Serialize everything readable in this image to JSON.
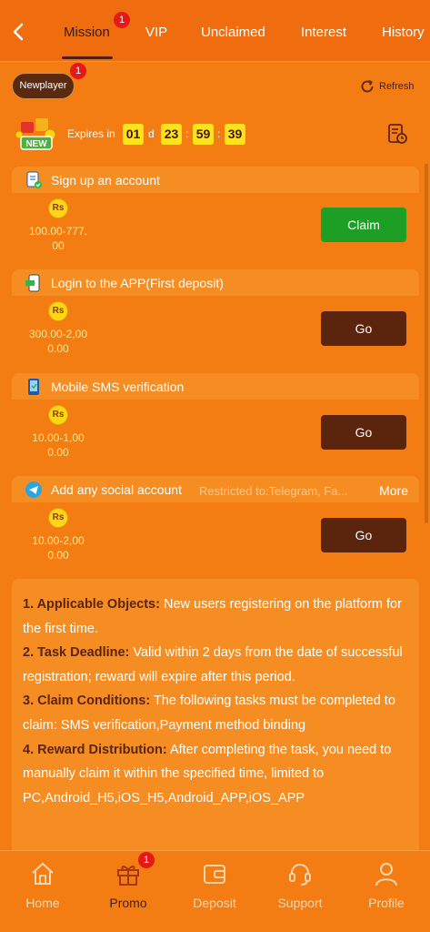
{
  "topnav": {
    "tabs": [
      {
        "label": "Mission",
        "badge": "1"
      },
      {
        "label": "VIP"
      },
      {
        "label": "Unclaimed"
      },
      {
        "label": "Interest"
      },
      {
        "label": "History"
      }
    ]
  },
  "subheader": {
    "newplayer_label": "Newplayer",
    "newplayer_badge": "1",
    "refresh_label": "Refresh",
    "new_tag": "NEW",
    "expires_label": "Expires in",
    "days": "01",
    "day_unit": "d",
    "hours": "23",
    "minutes": "59",
    "seconds": "39",
    "sep": ":"
  },
  "tasks": [
    {
      "title": "Sign up an account",
      "currency": "Rs",
      "reward_line1": "100.00-777.",
      "reward_line2": "00",
      "button": "Claim",
      "icon": "account-icon"
    },
    {
      "title": "Login to the APP(First deposit)",
      "currency": "Rs",
      "reward_line1": "300.00-2,00",
      "reward_line2": "0.00",
      "button": "Go",
      "icon": "app-login-icon"
    },
    {
      "title": "Mobile SMS verification",
      "currency": "Rs",
      "reward_line1": "10.00-1,00",
      "reward_line2": "0.00",
      "button": "Go",
      "icon": "mobile-sms-icon"
    },
    {
      "title": "Add any social account",
      "restricted": "Restricted to:Telegram, Fa...",
      "more": "More",
      "currency": "Rs",
      "reward_line1": "10.00-2,00",
      "reward_line2": "0.00",
      "button": "Go",
      "icon": "social-icon"
    }
  ],
  "rules": [
    {
      "head": "1. Applicable Objects:",
      "text": " New users registering on the platform for the first time."
    },
    {
      "head": "2. Task Deadline:",
      "text": " Valid within 2 days from the date of successful registration; reward will expire after this period."
    },
    {
      "head": "3. Claim Conditions:",
      "text": " The following tasks must be completed to claim: SMS verification,Payment method binding"
    },
    {
      "head": "4. Reward Distribution:",
      "text": " After completing the task, you need to manually claim it within the specified time, limited to PC,Android_H5,iOS_H5,Android_APP,iOS_APP"
    }
  ],
  "bottomnav": {
    "items": [
      {
        "label": "Home",
        "icon": "home-icon"
      },
      {
        "label": "Promo",
        "icon": "gift-icon",
        "badge": "1"
      },
      {
        "label": "Deposit",
        "icon": "wallet-icon"
      },
      {
        "label": "Support",
        "icon": "headset-icon"
      },
      {
        "label": "Profile",
        "icon": "user-icon"
      }
    ]
  },
  "colors": {
    "background": "#f47d13",
    "card": "#f68d23",
    "claim_button": "#1d9e24",
    "go_button": "#5a240d",
    "timer": "#ffe21a"
  }
}
